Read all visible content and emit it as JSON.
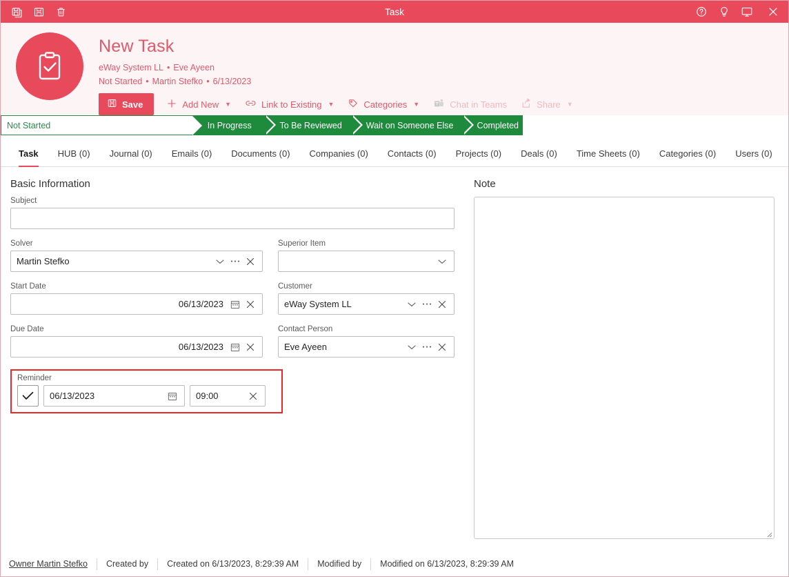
{
  "window": {
    "title": "Task",
    "left_buttons": [
      {
        "name": "save-and-new-icon",
        "label": "Save and New"
      },
      {
        "name": "save-icon",
        "label": "Save"
      },
      {
        "name": "delete-icon",
        "label": "Delete"
      }
    ],
    "right_buttons": [
      {
        "name": "help-icon",
        "label": "Help"
      },
      {
        "name": "lightbulb-icon",
        "label": "Tips"
      },
      {
        "name": "monitor-icon",
        "label": "Display"
      },
      {
        "name": "close-icon",
        "label": "Close"
      }
    ],
    "accent_red": "#E84A5C",
    "header_bg": "#FDF4F5",
    "status_green": "#1E8A3C",
    "highlight_red": "#EF2626"
  },
  "header": {
    "avatar_icon": "clipboard-check-icon",
    "title": "New Task",
    "subtitle_line1": [
      "eWay System LL",
      "Eve Ayeen"
    ],
    "subtitle_line2": [
      "Not Started",
      "Martin Stefko",
      "6/13/2023"
    ],
    "separator": "•"
  },
  "toolbar": {
    "items": [
      {
        "label": "Save",
        "icon": "floppy-disk-icon",
        "primary": true,
        "caret": false,
        "disabled": false
      },
      {
        "label": "Add New",
        "icon": "plus-icon",
        "primary": false,
        "caret": true,
        "disabled": false
      },
      {
        "label": "Link to Existing",
        "icon": "link-icon",
        "primary": false,
        "caret": true,
        "disabled": false
      },
      {
        "label": "Categories",
        "icon": "tag-icon",
        "primary": false,
        "caret": true,
        "disabled": false
      },
      {
        "label": "Chat in Teams",
        "icon": "teams-icon",
        "primary": false,
        "caret": false,
        "disabled": true
      },
      {
        "label": "Share",
        "icon": "share-icon",
        "primary": false,
        "caret": true,
        "disabled": true
      }
    ]
  },
  "status_flow": {
    "steps": [
      {
        "label": "Not Started",
        "active": true
      },
      {
        "label": "In Progress",
        "active": false
      },
      {
        "label": "To Be Reviewed",
        "active": false
      },
      {
        "label": "Wait on Someone Else",
        "active": false
      },
      {
        "label": "Completed",
        "active": false
      }
    ]
  },
  "tabs": [
    {
      "label": "Task",
      "active": true
    },
    {
      "label": "HUB (0)",
      "active": false
    },
    {
      "label": "Journal (0)",
      "active": false
    },
    {
      "label": "Emails (0)",
      "active": false
    },
    {
      "label": "Documents (0)",
      "active": false
    },
    {
      "label": "Companies (0)",
      "active": false
    },
    {
      "label": "Contacts (0)",
      "active": false
    },
    {
      "label": "Projects (0)",
      "active": false
    },
    {
      "label": "Deals (0)",
      "active": false
    },
    {
      "label": "Time Sheets (0)",
      "active": false
    },
    {
      "label": "Categories (0)",
      "active": false
    },
    {
      "label": "Users (0)",
      "active": false
    }
  ],
  "form": {
    "section_title": "Basic Information",
    "subject": {
      "label": "Subject",
      "value": ""
    },
    "solver": {
      "label": "Solver",
      "value": "Martin Stefko"
    },
    "superior_item": {
      "label": "Superior Item",
      "value": ""
    },
    "start_date": {
      "label": "Start Date",
      "value": "06/13/2023"
    },
    "customer": {
      "label": "Customer",
      "value": "eWay System LL"
    },
    "due_date": {
      "label": "Due Date",
      "value": "06/13/2023"
    },
    "contact_person": {
      "label": "Contact Person",
      "value": "Eve Ayeen"
    },
    "reminder": {
      "label": "Reminder",
      "checked": true,
      "date": "06/13/2023",
      "time": "09:00",
      "highlighted": true
    }
  },
  "note": {
    "label": "Note",
    "value": ""
  },
  "footer": {
    "owner": "Owner Martin Stefko",
    "created_by": "Created by",
    "created_on": "Created on 6/13/2023, 8:29:39 AM",
    "modified_by": "Modified by",
    "modified_on": "Modified on 6/13/2023, 8:29:39 AM"
  }
}
